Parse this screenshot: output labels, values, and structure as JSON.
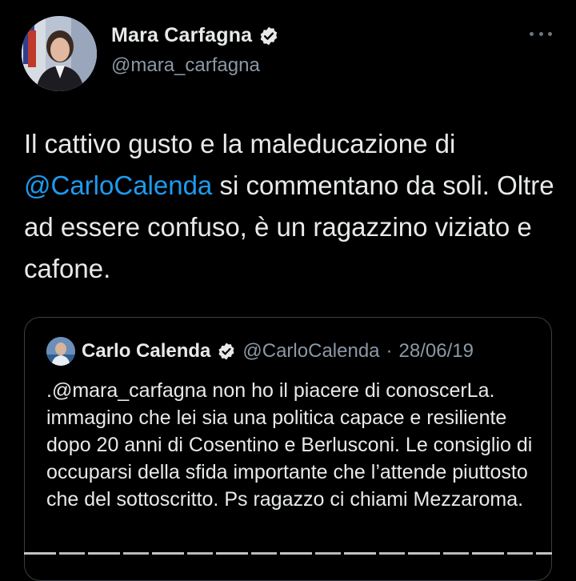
{
  "tweet": {
    "author_name": "Mara Carfagna",
    "author_handle": "@mara_carfagna",
    "text_before": "Il cattivo gusto e la maleducazione di ",
    "mention": "@CarloCalenda",
    "text_after": " si commentano da soli. Oltre ad essere confuso, è un ragazzino viziato e cafone."
  },
  "quote": {
    "author_name": "Carlo Calenda",
    "author_handle": "@CarloCalenda",
    "separator": "·",
    "date": "28/06/19",
    "text": ".@mara_carfagna non ho il piacere di conoscerLa. immagino che lei sia una politica capace e resiliente dopo 20 anni di Cosentino e Berlusconi. Le consiglio di occuparsi della sfida importante che l’attende piuttosto che del sottoscritto. Ps ragazzo ci chiami Mezzaroma."
  },
  "icons": {
    "verified": "verified-badge-icon",
    "more": "more-options-icon"
  },
  "colors": {
    "background": "#000000",
    "text": "#e7e9ea",
    "secondary_text": "#8b98a5",
    "link": "#1d9bf0",
    "border": "#3a3f44"
  }
}
